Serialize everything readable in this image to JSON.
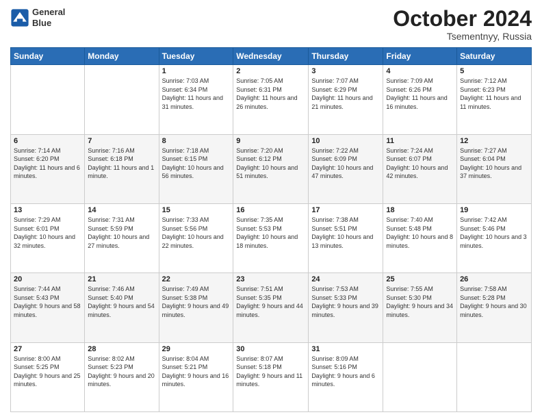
{
  "header": {
    "logo_line1": "General",
    "logo_line2": "Blue",
    "month": "October 2024",
    "location": "Tsementnyy, Russia"
  },
  "weekdays": [
    "Sunday",
    "Monday",
    "Tuesday",
    "Wednesday",
    "Thursday",
    "Friday",
    "Saturday"
  ],
  "weeks": [
    [
      {
        "day": "",
        "sunrise": "",
        "sunset": "",
        "daylight": ""
      },
      {
        "day": "",
        "sunrise": "",
        "sunset": "",
        "daylight": ""
      },
      {
        "day": "1",
        "sunrise": "Sunrise: 7:03 AM",
        "sunset": "Sunset: 6:34 PM",
        "daylight": "Daylight: 11 hours and 31 minutes."
      },
      {
        "day": "2",
        "sunrise": "Sunrise: 7:05 AM",
        "sunset": "Sunset: 6:31 PM",
        "daylight": "Daylight: 11 hours and 26 minutes."
      },
      {
        "day": "3",
        "sunrise": "Sunrise: 7:07 AM",
        "sunset": "Sunset: 6:29 PM",
        "daylight": "Daylight: 11 hours and 21 minutes."
      },
      {
        "day": "4",
        "sunrise": "Sunrise: 7:09 AM",
        "sunset": "Sunset: 6:26 PM",
        "daylight": "Daylight: 11 hours and 16 minutes."
      },
      {
        "day": "5",
        "sunrise": "Sunrise: 7:12 AM",
        "sunset": "Sunset: 6:23 PM",
        "daylight": "Daylight: 11 hours and 11 minutes."
      }
    ],
    [
      {
        "day": "6",
        "sunrise": "Sunrise: 7:14 AM",
        "sunset": "Sunset: 6:20 PM",
        "daylight": "Daylight: 11 hours and 6 minutes."
      },
      {
        "day": "7",
        "sunrise": "Sunrise: 7:16 AM",
        "sunset": "Sunset: 6:18 PM",
        "daylight": "Daylight: 11 hours and 1 minute."
      },
      {
        "day": "8",
        "sunrise": "Sunrise: 7:18 AM",
        "sunset": "Sunset: 6:15 PM",
        "daylight": "Daylight: 10 hours and 56 minutes."
      },
      {
        "day": "9",
        "sunrise": "Sunrise: 7:20 AM",
        "sunset": "Sunset: 6:12 PM",
        "daylight": "Daylight: 10 hours and 51 minutes."
      },
      {
        "day": "10",
        "sunrise": "Sunrise: 7:22 AM",
        "sunset": "Sunset: 6:09 PM",
        "daylight": "Daylight: 10 hours and 47 minutes."
      },
      {
        "day": "11",
        "sunrise": "Sunrise: 7:24 AM",
        "sunset": "Sunset: 6:07 PM",
        "daylight": "Daylight: 10 hours and 42 minutes."
      },
      {
        "day": "12",
        "sunrise": "Sunrise: 7:27 AM",
        "sunset": "Sunset: 6:04 PM",
        "daylight": "Daylight: 10 hours and 37 minutes."
      }
    ],
    [
      {
        "day": "13",
        "sunrise": "Sunrise: 7:29 AM",
        "sunset": "Sunset: 6:01 PM",
        "daylight": "Daylight: 10 hours and 32 minutes."
      },
      {
        "day": "14",
        "sunrise": "Sunrise: 7:31 AM",
        "sunset": "Sunset: 5:59 PM",
        "daylight": "Daylight: 10 hours and 27 minutes."
      },
      {
        "day": "15",
        "sunrise": "Sunrise: 7:33 AM",
        "sunset": "Sunset: 5:56 PM",
        "daylight": "Daylight: 10 hours and 22 minutes."
      },
      {
        "day": "16",
        "sunrise": "Sunrise: 7:35 AM",
        "sunset": "Sunset: 5:53 PM",
        "daylight": "Daylight: 10 hours and 18 minutes."
      },
      {
        "day": "17",
        "sunrise": "Sunrise: 7:38 AM",
        "sunset": "Sunset: 5:51 PM",
        "daylight": "Daylight: 10 hours and 13 minutes."
      },
      {
        "day": "18",
        "sunrise": "Sunrise: 7:40 AM",
        "sunset": "Sunset: 5:48 PM",
        "daylight": "Daylight: 10 hours and 8 minutes."
      },
      {
        "day": "19",
        "sunrise": "Sunrise: 7:42 AM",
        "sunset": "Sunset: 5:46 PM",
        "daylight": "Daylight: 10 hours and 3 minutes."
      }
    ],
    [
      {
        "day": "20",
        "sunrise": "Sunrise: 7:44 AM",
        "sunset": "Sunset: 5:43 PM",
        "daylight": "Daylight: 9 hours and 58 minutes."
      },
      {
        "day": "21",
        "sunrise": "Sunrise: 7:46 AM",
        "sunset": "Sunset: 5:40 PM",
        "daylight": "Daylight: 9 hours and 54 minutes."
      },
      {
        "day": "22",
        "sunrise": "Sunrise: 7:49 AM",
        "sunset": "Sunset: 5:38 PM",
        "daylight": "Daylight: 9 hours and 49 minutes."
      },
      {
        "day": "23",
        "sunrise": "Sunrise: 7:51 AM",
        "sunset": "Sunset: 5:35 PM",
        "daylight": "Daylight: 9 hours and 44 minutes."
      },
      {
        "day": "24",
        "sunrise": "Sunrise: 7:53 AM",
        "sunset": "Sunset: 5:33 PM",
        "daylight": "Daylight: 9 hours and 39 minutes."
      },
      {
        "day": "25",
        "sunrise": "Sunrise: 7:55 AM",
        "sunset": "Sunset: 5:30 PM",
        "daylight": "Daylight: 9 hours and 34 minutes."
      },
      {
        "day": "26",
        "sunrise": "Sunrise: 7:58 AM",
        "sunset": "Sunset: 5:28 PM",
        "daylight": "Daylight: 9 hours and 30 minutes."
      }
    ],
    [
      {
        "day": "27",
        "sunrise": "Sunrise: 8:00 AM",
        "sunset": "Sunset: 5:25 PM",
        "daylight": "Daylight: 9 hours and 25 minutes."
      },
      {
        "day": "28",
        "sunrise": "Sunrise: 8:02 AM",
        "sunset": "Sunset: 5:23 PM",
        "daylight": "Daylight: 9 hours and 20 minutes."
      },
      {
        "day": "29",
        "sunrise": "Sunrise: 8:04 AM",
        "sunset": "Sunset: 5:21 PM",
        "daylight": "Daylight: 9 hours and 16 minutes."
      },
      {
        "day": "30",
        "sunrise": "Sunrise: 8:07 AM",
        "sunset": "Sunset: 5:18 PM",
        "daylight": "Daylight: 9 hours and 11 minutes."
      },
      {
        "day": "31",
        "sunrise": "Sunrise: 8:09 AM",
        "sunset": "Sunset: 5:16 PM",
        "daylight": "Daylight: 9 hours and 6 minutes."
      },
      {
        "day": "",
        "sunrise": "",
        "sunset": "",
        "daylight": ""
      },
      {
        "day": "",
        "sunrise": "",
        "sunset": "",
        "daylight": ""
      }
    ]
  ]
}
